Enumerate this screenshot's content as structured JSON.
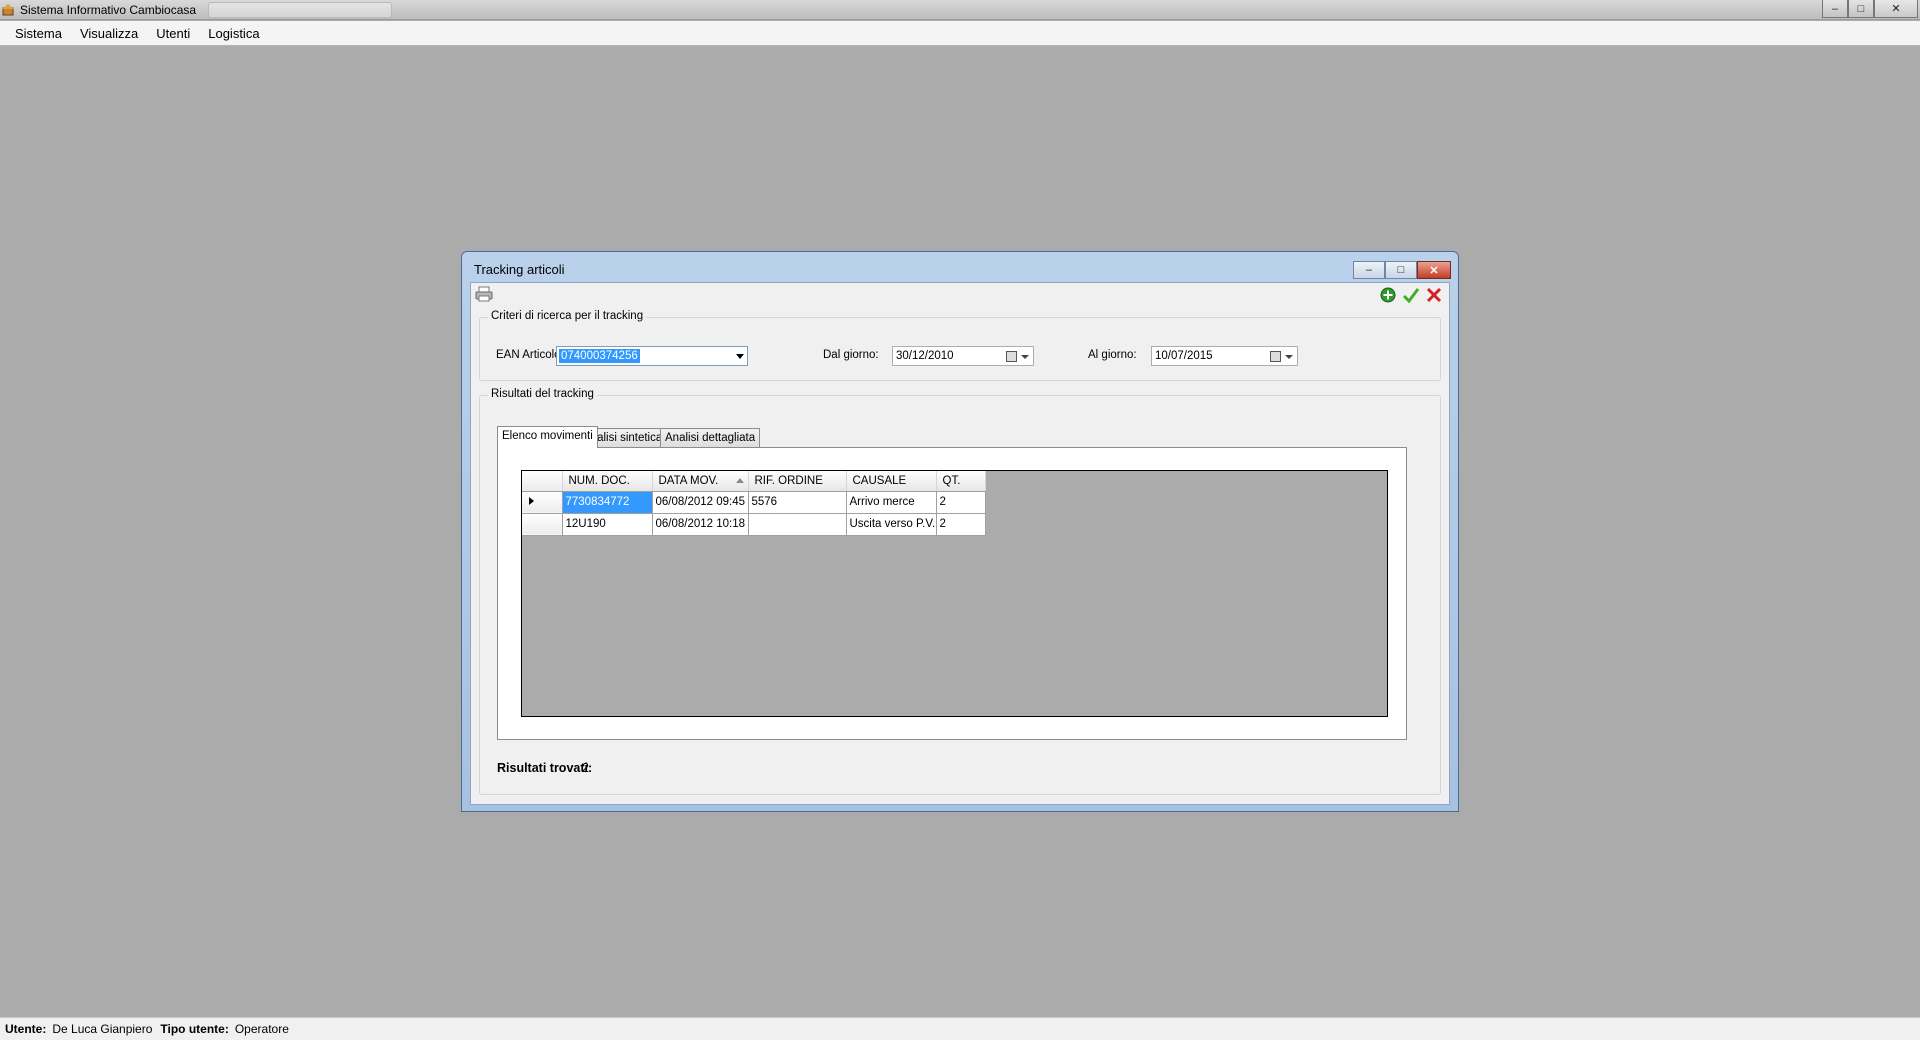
{
  "app": {
    "title": "Sistema Informativo Cambiocasa",
    "window_buttons": {
      "minimize": "–",
      "maximize": "□",
      "close": "✕"
    }
  },
  "menu": {
    "items": [
      "Sistema",
      "Visualizza",
      "Utenti",
      "Logistica"
    ]
  },
  "child_window": {
    "title": "Tracking articoli",
    "buttons": {
      "minimize": "–",
      "maximize": "□",
      "close": "✕"
    },
    "toolbar": {
      "icons": [
        "print-icon",
        "add-icon",
        "confirm-check-icon",
        "cancel-x-icon"
      ]
    },
    "criteria": {
      "group_label": "Criteri di ricerca per il tracking",
      "ean_label": "EAN Articolo:",
      "ean_value": "074000374256",
      "from_label": "Dal giorno:",
      "from_value": "30/12/2010",
      "to_label": "Al giorno:",
      "to_value": "10/07/2015"
    },
    "results": {
      "group_label": "Risultati del tracking",
      "tabs": [
        "Elenco movimenti",
        "Analisi sintetica",
        "Analisi dettagliata"
      ],
      "active_tab": "Elenco movimenti",
      "columns": [
        "NUM. DOC.",
        "DATA MOV.",
        "RIF. ORDINE",
        "CAUSALE",
        "QT."
      ],
      "sorted_column": "DATA MOV.",
      "rows": [
        [
          "7730834772",
          "06/08/2012 09:45",
          "5576",
          "Arrivo merce",
          "2"
        ],
        [
          "12U190",
          "06/08/2012 10:18",
          "",
          "Uscita verso P.V.",
          "2"
        ]
      ],
      "found_label": "Risultati trovati:",
      "found_value": "2"
    }
  },
  "status": {
    "user_label": "Utente:",
    "user_value": "De Luca Gianpiero",
    "type_label": "Tipo utente:",
    "type_value": "Operatore"
  },
  "colors": {
    "mdi_background": "#ababab",
    "selection": "#3399ff",
    "child_title_gradient_top": "#b9d1ea"
  }
}
